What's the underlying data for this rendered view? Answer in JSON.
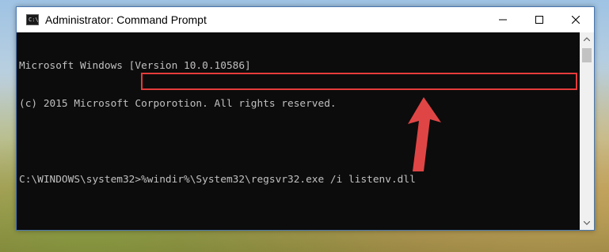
{
  "window": {
    "title": "Administrator: Command Prompt",
    "icon": "cmd-icon",
    "icon_glyph": "C:\\"
  },
  "console": {
    "lines": [
      "Microsoft Windows [Version 10.0.10586]",
      "(c) 2015 Microsoft Corporotion. All rights reserved.",
      "",
      "C:\\WINDOWS\\system32>%windir%\\System32\\regsvr32.exe /i listenv.dll"
    ]
  },
  "colors": {
    "highlight": "#e53b3b",
    "console_text": "#c0c0c0",
    "console_bg": "#0c0c0c"
  },
  "icons": {
    "minimize": "minimize-icon",
    "maximize": "maximize-icon",
    "close": "close-icon",
    "scroll_up": "scroll-up-arrow-icon",
    "scroll_down": "scroll-down-arrow-icon",
    "annotation": "red-arrow-icon"
  }
}
